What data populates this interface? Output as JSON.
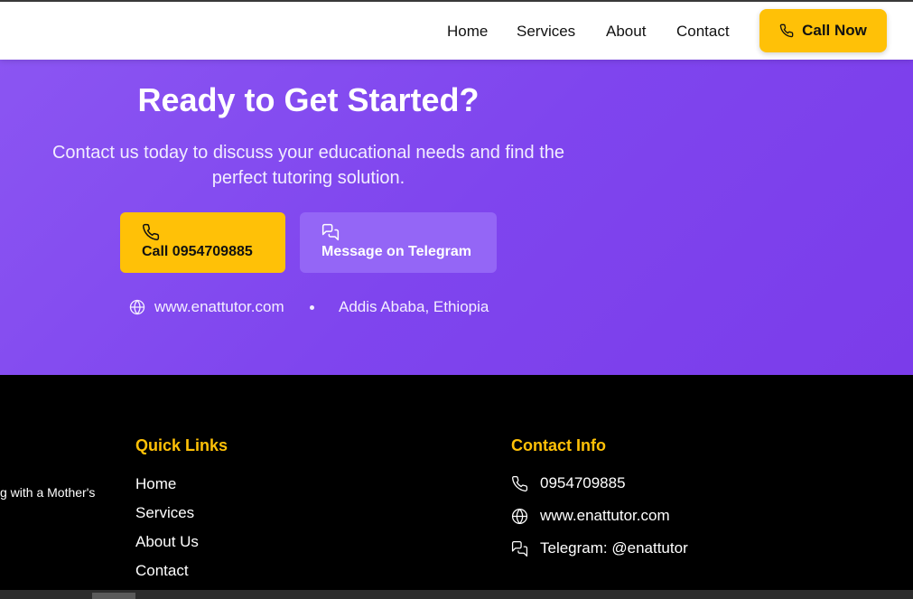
{
  "nav": {
    "links": [
      "Home",
      "Services",
      "About",
      "Contact"
    ],
    "call_now": "Call Now"
  },
  "hero": {
    "title": "Ready to Get Started?",
    "description": "Contact us today to discuss your educational needs and find the perfect tutoring solution.",
    "call_button": "Call 0954709885",
    "telegram_button": "Message on Telegram",
    "website": "www.enattutor.com",
    "location": "Addis Ababa, Ethiopia"
  },
  "footer": {
    "tagline_fragment": "g with a Mother's",
    "quick_links_heading": "Quick Links",
    "quick_links": [
      "Home",
      "Services",
      "About Us",
      "Contact"
    ],
    "contact_heading": "Contact Info",
    "contact": {
      "phone": "0954709885",
      "website": "www.enattutor.com",
      "telegram": "Telegram: @enattutor"
    }
  },
  "colors": {
    "accent_yellow": "#FFC107",
    "hero_purple": "#8047EE",
    "telegram_button": "#9466F6",
    "footer_bg": "#000000"
  },
  "icons": {
    "phone": "phone-icon",
    "chat": "chat-icon",
    "globe": "globe-icon"
  }
}
